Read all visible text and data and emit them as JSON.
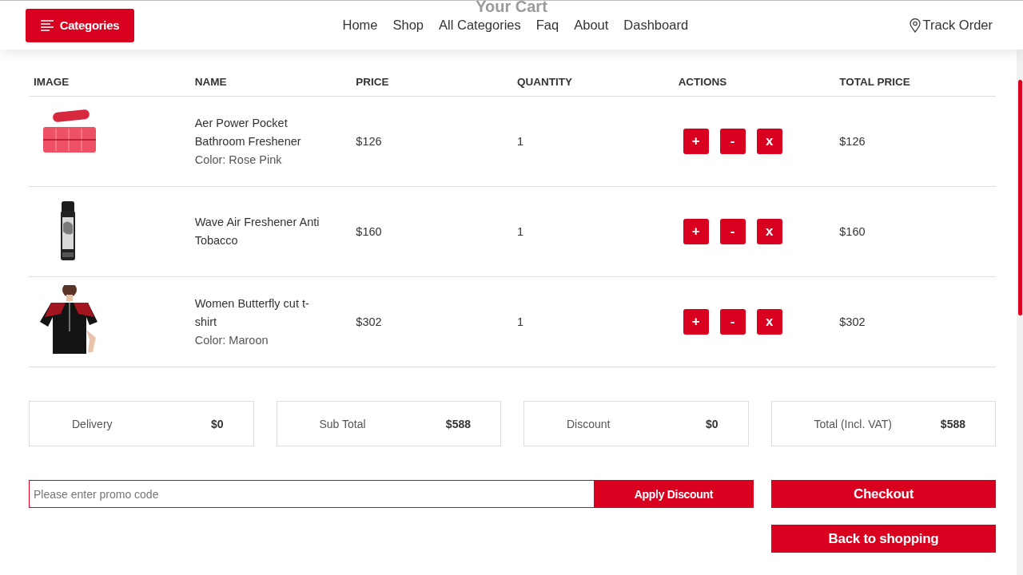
{
  "page_title": "Your Cart",
  "header": {
    "categories_button": "Categories",
    "nav": [
      {
        "label": "Home"
      },
      {
        "label": "Shop"
      },
      {
        "label": "All Categories"
      },
      {
        "label": "Faq"
      },
      {
        "label": "About"
      },
      {
        "label": "Dashboard"
      }
    ],
    "track_order": "Track Order"
  },
  "table": {
    "columns": [
      "IMAGE",
      "NAME",
      "PRICE",
      "QUANTITY",
      "ACTIONS",
      "TOTAL PRICE"
    ],
    "rows": [
      {
        "image": {
          "kind": "picture"
        },
        "name": "Aer Power Pocket Bathroom Freshener",
        "variant": "Color: Rose Pink",
        "price": "$126",
        "quantity": "1",
        "actions": [
          "+",
          "-",
          "x"
        ],
        "total": "$126"
      },
      {
        "image": {
          "kind": "picture"
        },
        "name": "Wave Air Freshener Anti Tobacco",
        "price": "$160",
        "quantity": "1",
        "actions": [
          "+",
          "-",
          "x"
        ],
        "total": "$160"
      },
      {
        "image": {
          "kind": "picture"
        },
        "name": "Women Butterfly cut t-shirt",
        "variant": "Color: Maroon",
        "price": "$302",
        "quantity": "1",
        "actions": [
          "+",
          "-",
          "x"
        ],
        "total": "$302"
      }
    ]
  },
  "summary": [
    {
      "label": "Delivery",
      "value": "$0"
    },
    {
      "label": "Sub Total",
      "value": "$588"
    },
    {
      "label": "Discount",
      "value": "$0"
    },
    {
      "label": "Total (Incl. VAT)",
      "value": "$588"
    }
  ],
  "promo": {
    "placeholder": "Please enter promo code",
    "button": "Apply Discount"
  },
  "buttons": [
    "Checkout",
    "Back to shopping"
  ]
}
